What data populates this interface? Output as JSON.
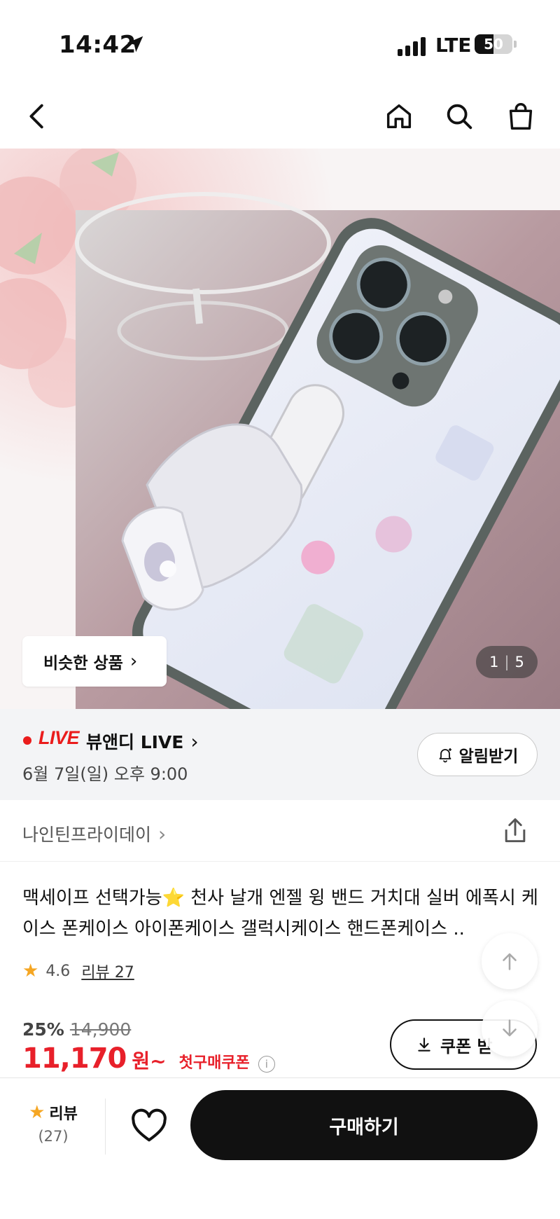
{
  "status_bar": {
    "time": "14:42",
    "network": "LTE",
    "battery": "50",
    "battery_level": 0.5
  },
  "nav": {
    "icons": [
      "back-icon",
      "home-icon",
      "search-icon",
      "shopping-bag-icon"
    ]
  },
  "gallery": {
    "similar_label": "비슷한 상품",
    "current_page": "1",
    "page_separator": "|",
    "total_pages": "5"
  },
  "live": {
    "badge": "LIVE",
    "title": "뷰앤디 LIVE",
    "schedule": "6월 7일(일) 오후 9:00",
    "notify_label": "알림받기"
  },
  "seller": {
    "name": "나인틴프라이데이"
  },
  "product": {
    "title": "맥세이프 선택가능⭐️ 천사 날개 엔젤 윙 밴드 거치대 실버 에폭시 케이스 폰케이스 아이폰케이스 갤럭시케이스 핸드폰케이스 ..",
    "rating": "4.6",
    "review_label": "리뷰 27"
  },
  "price": {
    "discount_rate": "25%",
    "original_price": "14,900",
    "sale_price": "11,170",
    "unit": "원~",
    "coupon_label": "첫구매쿠폰",
    "coupon_button": "쿠폰 받"
  },
  "bottom_bar": {
    "review_label": "리뷰",
    "review_count": "(27)",
    "buy_label": "구매하기"
  },
  "colors": {
    "accent_red": "#e8202a",
    "live_red": "#ea1c1c",
    "star": "#f5a623",
    "buy_button": "#111111"
  }
}
